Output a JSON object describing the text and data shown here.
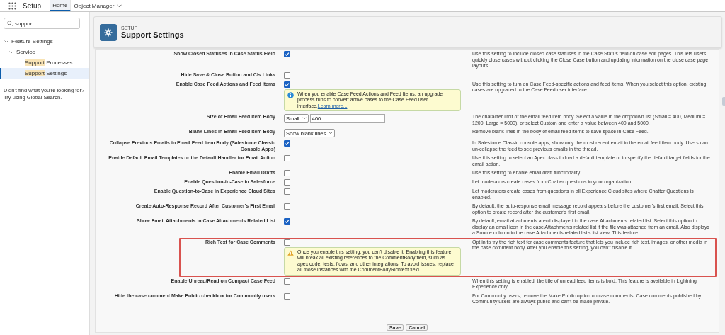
{
  "top_bar": {
    "app_name": "Setup",
    "tabs": [
      {
        "label": "Home",
        "selected": true,
        "dropdown": false
      },
      {
        "label": "Object Manager",
        "selected": false,
        "dropdown": true
      }
    ]
  },
  "sidebar": {
    "search": {
      "value": "support"
    },
    "tree": [
      {
        "label": "Feature Settings",
        "expanded": true,
        "children": [
          {
            "label": "Service",
            "expanded": true,
            "children": [
              {
                "match": "Support",
                "rest": " Processes",
                "selected": false
              },
              {
                "match": "Support",
                "rest": " Settings",
                "selected": true
              }
            ]
          }
        ]
      }
    ],
    "hint": [
      "Didn't find what you're looking for?",
      "Try using Global Search."
    ]
  },
  "header": {
    "eyebrow": "SETUP",
    "title": "Support Settings"
  },
  "settings": [
    {
      "label": "Show Closed Statuses in Case Status Field",
      "kind": "checkbox",
      "checked": true,
      "description": "Use this setting to include closed case statuses in the Case Status field on case edit pages. This lets users quickly close cases without clicking the Close Case button and updating information on the close case page layouts."
    },
    {
      "label": "Hide Save & Close Button and Cls Links",
      "kind": "checkbox",
      "checked": false
    },
    {
      "label": "Enable Case Feed Actions and Feed Items",
      "kind": "checkbox",
      "checked": true,
      "description": "Use this setting to turn on Case Feed-specific actions and feed items. When you select this option, existing cases are upgraded to the Case Feed user interface.",
      "note": {
        "kind": "info",
        "text": "When you enable Case Feed Actions and Feed Items, an upgrade process runs to convert active cases to the Case Feed user interface.",
        "link": "Learn more..."
      }
    },
    {
      "label": "Size of Email Feed Item Body",
      "kind": "select_input",
      "select": "Small",
      "input": "400",
      "description": "The character limit of the email feed item body. Select a value in the dropdown list (Small = 400, Medium = 1200, Large = 5000), or select Custom and enter a value between 400 and 5000."
    },
    {
      "label": "Blank Lines in Email Feed Item Body",
      "kind": "select",
      "select": "Show blank lines",
      "description": "Remove blank lines in the body of email feed items to save space in Case Feed."
    },
    {
      "label": "Collapse Previous Emails in Email Feed Item Body (Salesforce Classic Console Apps)",
      "kind": "checkbox",
      "checked": true,
      "description": "In Salesforce Classic console apps, show only the most recent email in the email feed item body. Users can un-collapse the feed to see previous emails in the thread."
    },
    {
      "label": "Enable Default Email Templates or the Default Handler for Email Action",
      "kind": "checkbox",
      "checked": false,
      "description": "Use this setting to select an Apex class to load a default template or to specify the default target fields for the email action."
    },
    {
      "label": "Enable Email Drafts",
      "kind": "checkbox",
      "checked": false,
      "description": "Use this setting to enable email draft functionality"
    },
    {
      "label": "Enable Question-to-Case in Salesforce",
      "kind": "checkbox",
      "checked": false,
      "description": "Let moderators create cases from Chatter questions in your organization."
    },
    {
      "label": "Enable Question-to-Case in Experience Cloud Sites",
      "kind": "checkbox",
      "checked": false,
      "description": "Let moderators create cases from questions in all Experience Cloud sites where Chatter Questions is enabled."
    },
    {
      "label": "Create Auto-Response Record After Customer's First Email",
      "kind": "checkbox",
      "checked": false,
      "description": "By default, the auto-response email message record appears before the customer's first email. Select this option to create record after the customer's first email."
    },
    {
      "label": "Show Email Attachments in Case Attachments Related List",
      "kind": "checkbox",
      "checked": true,
      "description": "By default, email attachments aren't displayed in the case Attachments related list. Select this option to display an email icon in the case Attachments related list if the file was attached from an email. Also displays a Source column in the case Attachments related list's list view. This feature"
    },
    {
      "label": "Rich Text for Case Comments",
      "kind": "checkbox",
      "checked": false,
      "highlighted": true,
      "description": "Opt in to try the rich text for case comments feature that lets you include rich text, images, or other media in the case comment body. After you enable this setting, you can't disable it.",
      "note": {
        "kind": "warning",
        "text": "Once you enable this setting, you can't disable it. Enabling this feature will break all existing references to the CommentBody field, such as apex code, tests, flows, and other integrations. To avoid issues, replace all those instances with the CommentBodyRichtext field."
      }
    },
    {
      "label": "Enable Unread/Read on Compact Case Feed",
      "kind": "checkbox",
      "checked": false,
      "description": "When this setting is enabled, the title of unread feed items is bold. This feature is available in Lightning Experience only."
    },
    {
      "label": "Hide the case comment Make Public checkbox for Community users",
      "kind": "checkbox",
      "checked": false,
      "description": "For Community users, remove the Make Public option on case comments. Case comments published by Community users are always public and can't be made private."
    }
  ],
  "buttons": [
    "Save",
    "Cancel"
  ]
}
